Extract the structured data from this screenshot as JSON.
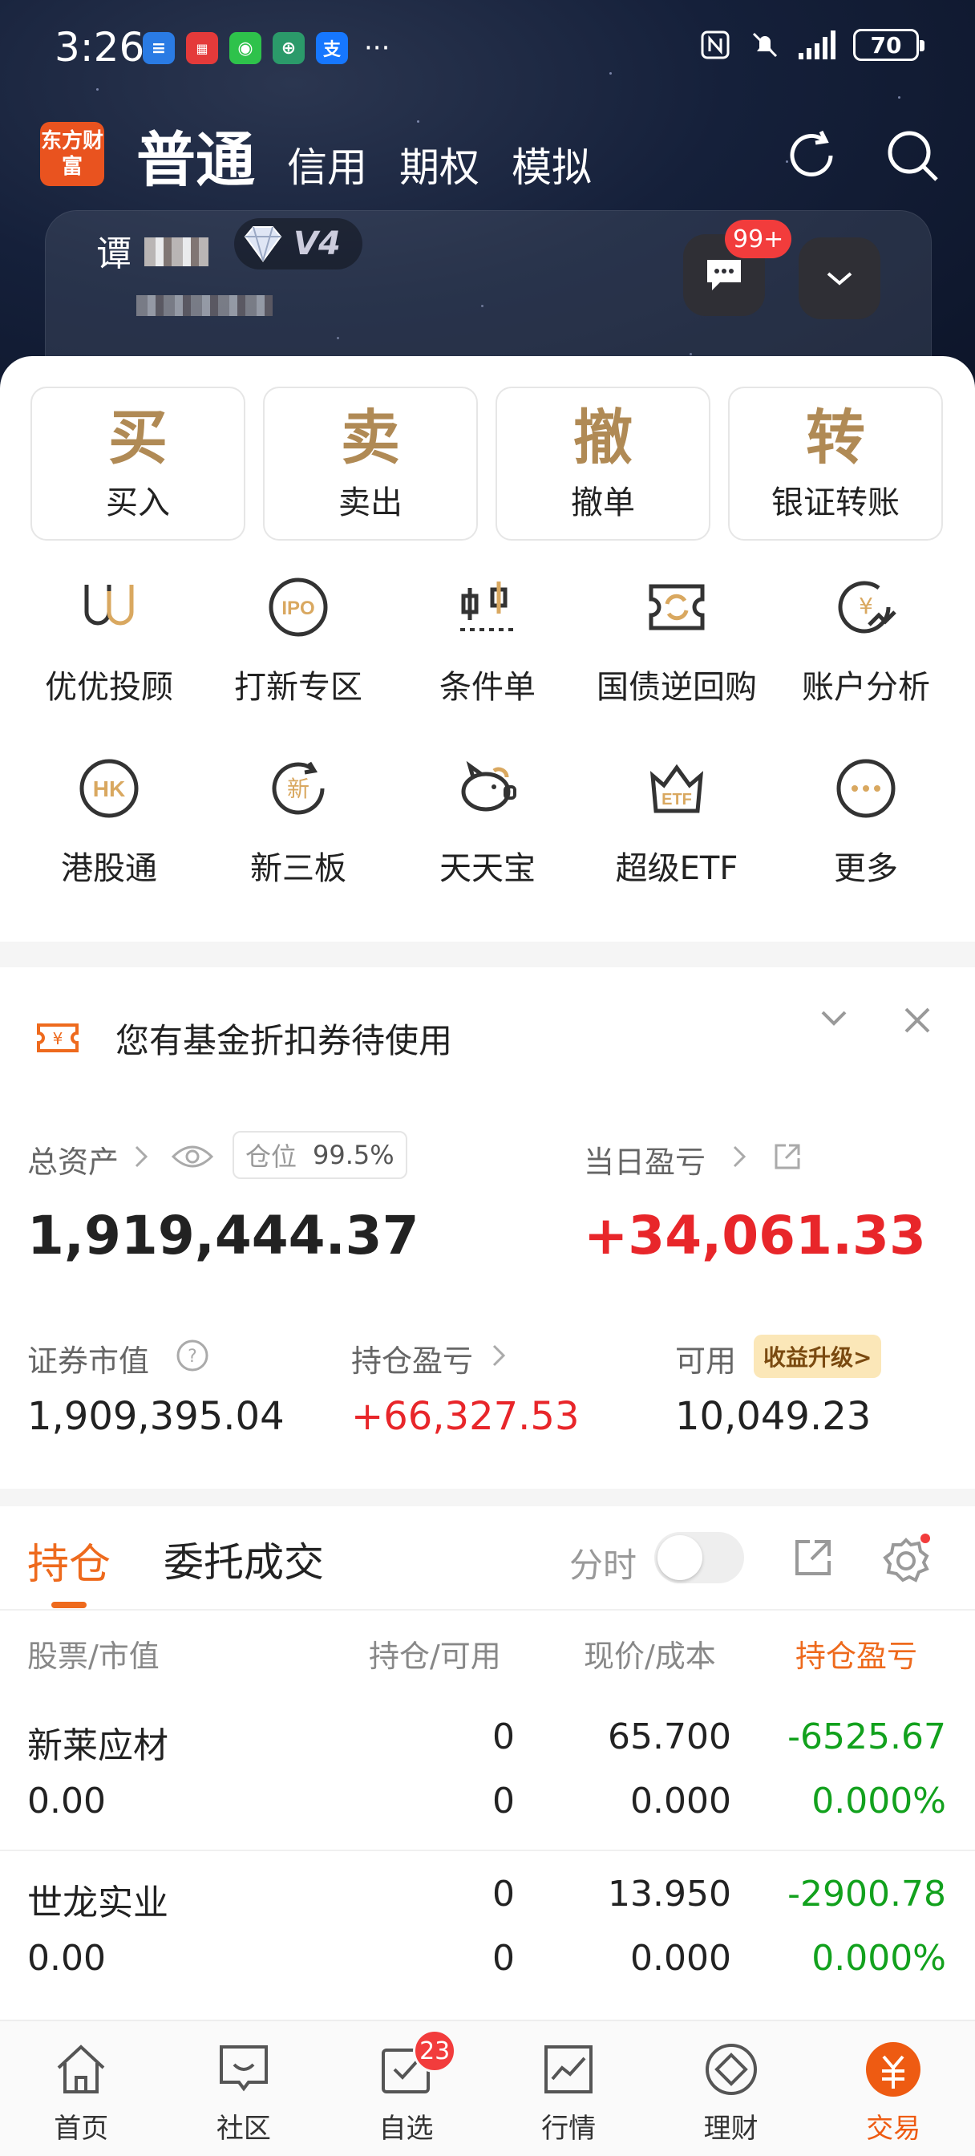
{
  "status_bar": {
    "time": "3:26",
    "battery": "70",
    "more": "···"
  },
  "header": {
    "logo": "东方财富",
    "active_tab": "普通",
    "tabs": [
      "信用",
      "期权",
      "模拟"
    ],
    "user_name": "谭",
    "vip_level": "V4",
    "message_badge": "99+"
  },
  "trade_actions": [
    {
      "glyph": "买",
      "label": "买入"
    },
    {
      "glyph": "卖",
      "label": "卖出"
    },
    {
      "glyph": "撤",
      "label": "撤单"
    },
    {
      "glyph": "转",
      "label": "银证转账"
    }
  ],
  "features": [
    {
      "label": "优优投顾",
      "icon": "uu-advisor-icon"
    },
    {
      "label": "打新专区",
      "icon": "ipo-icon"
    },
    {
      "label": "条件单",
      "icon": "condition-order-icon"
    },
    {
      "label": "国债逆回购",
      "icon": "bond-repo-icon"
    },
    {
      "label": "账户分析",
      "icon": "account-analysis-icon"
    },
    {
      "label": "港股通",
      "icon": "hk-connect-icon"
    },
    {
      "label": "新三板",
      "icon": "new-third-board-icon"
    },
    {
      "label": "天天宝",
      "icon": "piggy-bank-icon"
    },
    {
      "label": "超级ETF",
      "icon": "etf-icon"
    },
    {
      "label": "更多",
      "icon": "more-icon"
    }
  ],
  "coupon": {
    "text": "您有基金折扣券待使用"
  },
  "assets": {
    "total_label": "总资产",
    "position_label": "仓位",
    "position_value": "99.5%",
    "total_value": "1,919,444.37",
    "daily_pnl_label": "当日盈亏",
    "daily_pnl_value": "+34,061.33",
    "market_value_label": "证券市值",
    "market_value": "1,909,395.04",
    "holding_pnl_label": "持仓盈亏",
    "holding_pnl": "+66,327.53",
    "available_label": "可用",
    "available_value": "10,049.23",
    "upgrade_tag": "收益升级>"
  },
  "holdings": {
    "tab_active": "持仓",
    "tab_other": "委托成交",
    "fenshi_label": "分时",
    "headers": [
      "股票/市值",
      "持仓/可用",
      "现价/成本",
      "持仓盈亏"
    ],
    "rows": [
      {
        "name": "新莱应材",
        "market_value": "0.00",
        "position": "0",
        "available": "0",
        "price": "65.700",
        "cost": "0.000",
        "pnl": "-6525.67",
        "pnl_pct": "0.000%"
      },
      {
        "name": "世龙实业",
        "market_value": "0.00",
        "position": "0",
        "available": "0",
        "price": "13.950",
        "cost": "0.000",
        "pnl": "-2900.78",
        "pnl_pct": "0.000%"
      }
    ]
  },
  "bottom_nav": [
    {
      "label": "首页",
      "icon": "home-icon"
    },
    {
      "label": "社区",
      "icon": "community-icon"
    },
    {
      "label": "自选",
      "icon": "watchlist-icon",
      "badge": "23"
    },
    {
      "label": "行情",
      "icon": "market-icon"
    },
    {
      "label": "理财",
      "icon": "wealth-icon"
    },
    {
      "label": "交易",
      "icon": "trade-icon",
      "active": true
    }
  ],
  "colors": {
    "accent": "#ee6a1d",
    "up": "#e8262a",
    "down": "#12a11d",
    "gold": "#b08a55"
  }
}
